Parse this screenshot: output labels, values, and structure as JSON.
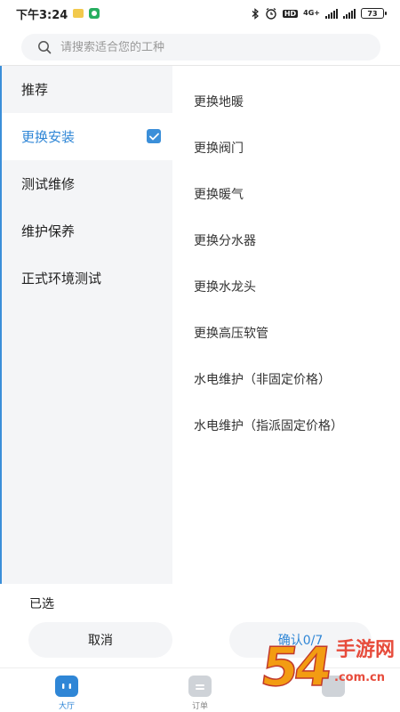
{
  "status_bar": {
    "time": "下午3:24",
    "network": "4G+",
    "battery": "73"
  },
  "search": {
    "placeholder": "请搜索适合您的工种"
  },
  "categories": [
    {
      "label": "推荐",
      "active": false
    },
    {
      "label": "更换安装",
      "active": true,
      "checked": true
    },
    {
      "label": "测试维修",
      "active": false
    },
    {
      "label": "维护保养",
      "active": false
    },
    {
      "label": "正式环境测试",
      "active": false
    }
  ],
  "sub_items": [
    {
      "label": "更换地暖"
    },
    {
      "label": "更换阀门"
    },
    {
      "label": "更换暖气"
    },
    {
      "label": "更换分水器"
    },
    {
      "label": "更换水龙头"
    },
    {
      "label": "更换高压软管"
    },
    {
      "label": "水电维护（非固定价格）"
    },
    {
      "label": "水电维护（指派固定价格）"
    }
  ],
  "selection": {
    "selected_label": "已选",
    "cancel_label": "取消",
    "confirm_label": "确认0/7"
  },
  "bottom_nav": [
    {
      "label": "大厅",
      "icon": "hall-icon",
      "active": true
    },
    {
      "label": "订单",
      "icon": "clipboard-icon",
      "active": false
    },
    {
      "label": "",
      "icon": "profile-icon",
      "active": false
    }
  ],
  "watermark": {
    "big": "54",
    "brand": "手游网",
    "domain": ".com.cn"
  },
  "colors": {
    "accent": "#2f86d6",
    "panel_bg": "#f4f5f7"
  }
}
